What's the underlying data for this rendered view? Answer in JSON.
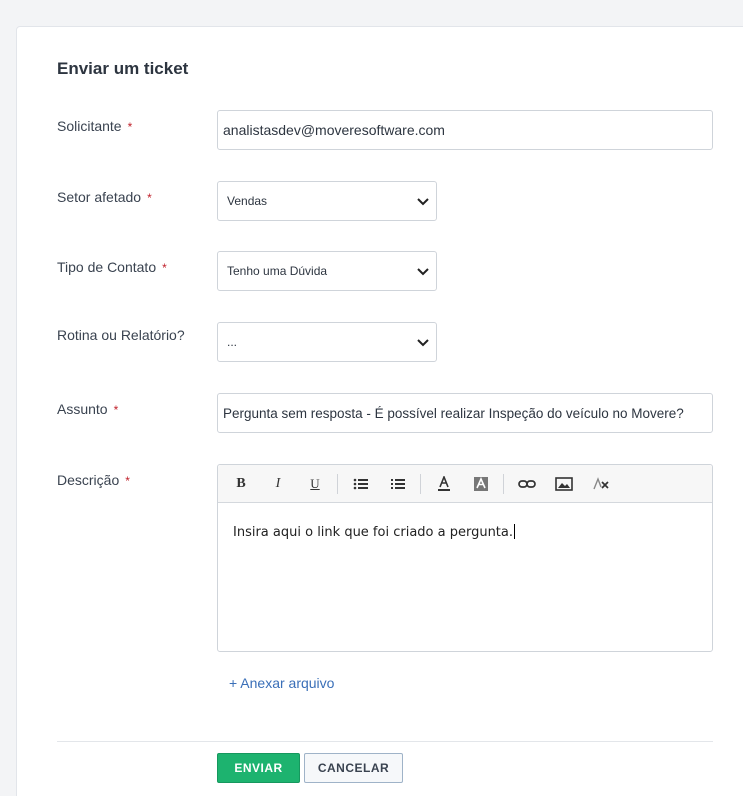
{
  "form": {
    "title": "Enviar um ticket",
    "required_mark": "*",
    "requester": {
      "label": "Solicitante",
      "value": "analistasdev@moveresoftware.com"
    },
    "sector": {
      "label": "Setor afetado",
      "value": "Vendas"
    },
    "contact_type": {
      "label": "Tipo de Contato",
      "value": "Tenho uma Dúvida"
    },
    "routine": {
      "label": "Rotina ou Relatório?",
      "value": "..."
    },
    "subject": {
      "label": "Assunto",
      "value": "Pergunta sem resposta - É possível realizar Inspeção do veículo no Movere?"
    },
    "description": {
      "label": "Descrição",
      "value": "Insira aqui o link que foi criado a pergunta."
    },
    "attach_link": "+ Anexar arquivo",
    "submit_label": "ENVIAR",
    "cancel_label": "CANCELAR"
  },
  "toolbar": {
    "bold": "B",
    "italic": "I",
    "underline": "U",
    "icons": [
      "bold-icon",
      "italic-icon",
      "underline-icon",
      "bullet-list-icon",
      "numbered-list-icon",
      "text-color-icon",
      "background-color-icon",
      "link-icon",
      "image-icon",
      "clear-format-icon"
    ]
  },
  "colors": {
    "accent": "#1db36f",
    "link": "#3a6fb8",
    "required": "#c0202a"
  }
}
